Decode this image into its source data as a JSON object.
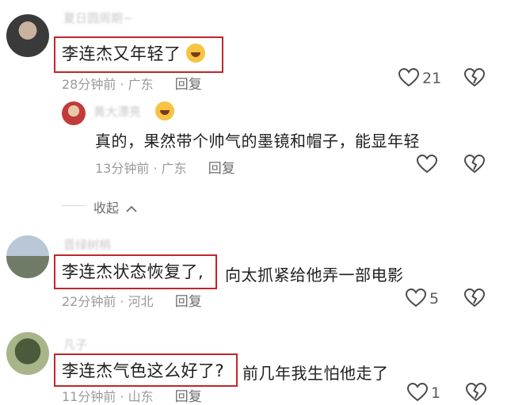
{
  "comments": [
    {
      "username": "夏日圆周期~",
      "highlight": "李连杰又年轻了",
      "text": "",
      "time": "28分钟前",
      "region": "广东",
      "reply": "回复",
      "likes": "21"
    },
    {
      "username": "黄大漂亮",
      "text": "真的，果然带个帅气的墨镜和帽子，能显年轻",
      "time": "13分钟前",
      "region": "广东",
      "reply": "回复"
    },
    {
      "username": "晋绿树梢",
      "highlight": "李连杰状态恢复了,",
      "text": "向太抓紧给他弄一部电影",
      "time": "22分钟前",
      "region": "河北",
      "reply": "回复",
      "likes": "5"
    },
    {
      "username": "凡子",
      "highlight": "李连杰气色这么好了?",
      "text": "前几年我生怕他走了",
      "time": "11分钟前",
      "region": "山东",
      "reply": "回复",
      "likes": "1"
    }
  ],
  "collapse_label": "收起",
  "meta_separator": "·",
  "colors": {
    "highlight_border": "#c0262a",
    "meta": "#9a9a9a"
  }
}
